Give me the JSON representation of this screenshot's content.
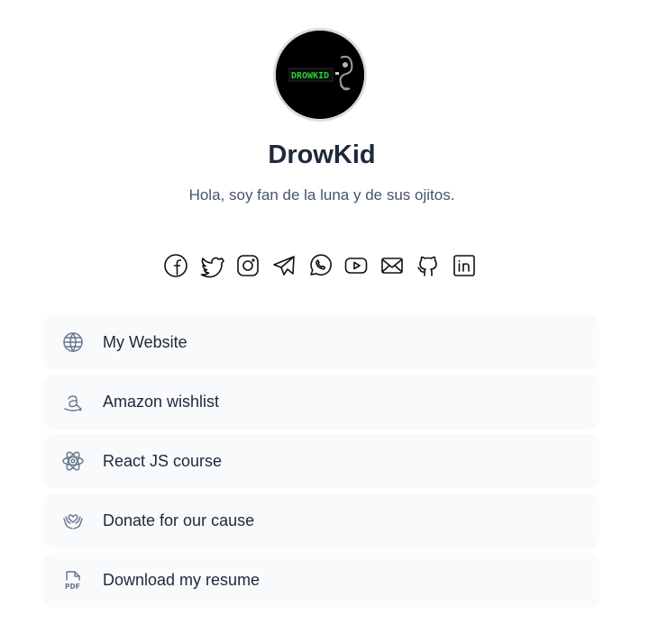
{
  "profile": {
    "avatar_logo_text": "DROWKID",
    "name": "DrowKid",
    "bio": "Hola, soy fan de la luna y de sus ojitos."
  },
  "socials": [
    {
      "icon": "facebook-icon"
    },
    {
      "icon": "twitter-icon"
    },
    {
      "icon": "instagram-icon"
    },
    {
      "icon": "telegram-icon"
    },
    {
      "icon": "whatsapp-icon"
    },
    {
      "icon": "youtube-icon"
    },
    {
      "icon": "mail-icon"
    },
    {
      "icon": "github-icon"
    },
    {
      "icon": "linkedin-icon"
    }
  ],
  "links": [
    {
      "label": "My Website",
      "icon": "globe-icon"
    },
    {
      "label": "Amazon wishlist",
      "icon": "amazon-icon"
    },
    {
      "label": "React JS course",
      "icon": "react-icon"
    },
    {
      "label": "Donate for our cause",
      "icon": "donate-icon"
    },
    {
      "label": "Download my resume",
      "icon": "pdf-icon"
    }
  ],
  "colors": {
    "background": "#ffffff",
    "card": "#f8fafc",
    "text": "#1e293b",
    "muted": "#475569",
    "icon": "#64748b"
  }
}
